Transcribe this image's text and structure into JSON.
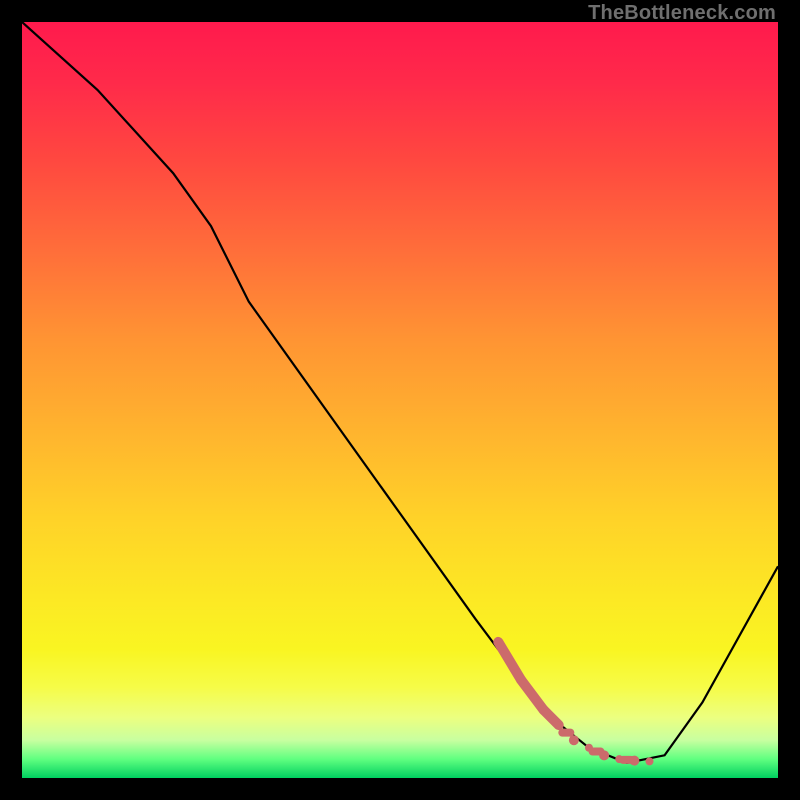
{
  "watermark": "TheBottleneck.com",
  "chart_data": {
    "type": "line",
    "title": "",
    "xlabel": "",
    "ylabel": "",
    "xlim": [
      0,
      100
    ],
    "ylim": [
      0,
      100
    ],
    "grid": false,
    "background": "rainbow-vertical-gradient",
    "series": [
      {
        "name": "main-curve",
        "color": "#000000",
        "x": [
          0,
          10,
          20,
          25,
          30,
          40,
          50,
          60,
          66,
          70,
          75,
          80,
          85,
          90,
          100
        ],
        "y": [
          100,
          91,
          80,
          73,
          63,
          49,
          35,
          21,
          13,
          8,
          4,
          2,
          3,
          10,
          28
        ]
      },
      {
        "name": "highlight-region",
        "color": "#cc6666",
        "style": "thick-dotted",
        "x": [
          63,
          66,
          69,
          71,
          73,
          75,
          77,
          79,
          81,
          83
        ],
        "y": [
          18,
          13,
          9,
          7,
          5,
          4,
          3,
          2.5,
          2.3,
          2.2
        ]
      }
    ]
  }
}
